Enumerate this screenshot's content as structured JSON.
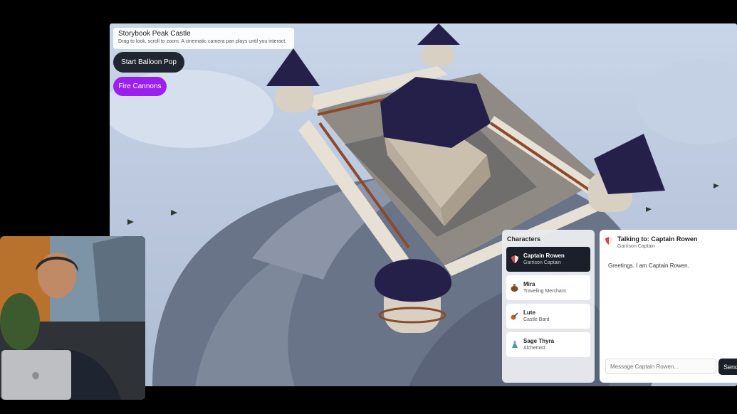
{
  "app": {
    "title": "Storybook Peak Castle",
    "subtitle": "Drag to look, scroll to zoom. A cinematic camera pan plays until you interact."
  },
  "controls": {
    "balloon_label": "Start Balloon Pop",
    "cannons_label": "Fire Cannons",
    "colors": {
      "dark": "#202631",
      "purple": "#9b20f0"
    }
  },
  "characters": {
    "header": "Characters",
    "items": [
      {
        "name": "Captain Rowen",
        "role": "Garrison Captain",
        "icon": "shield-icon"
      },
      {
        "name": "Mira",
        "role": "Traveling Merchant",
        "icon": "bag-icon"
      },
      {
        "name": "Lute",
        "role": "Castle Bard",
        "icon": "violin-icon"
      },
      {
        "name": "Sage Thyra",
        "role": "Alchemist",
        "icon": "flask-icon"
      }
    ],
    "selected": "Captain Rowen"
  },
  "chat": {
    "title": "Talking to: Captain Rowen",
    "role": "Garrison Captain",
    "message": "Greetings. I am Captain Rowen.",
    "input_placeholder": "Message Captain Rowen...",
    "send_label": "Send"
  }
}
